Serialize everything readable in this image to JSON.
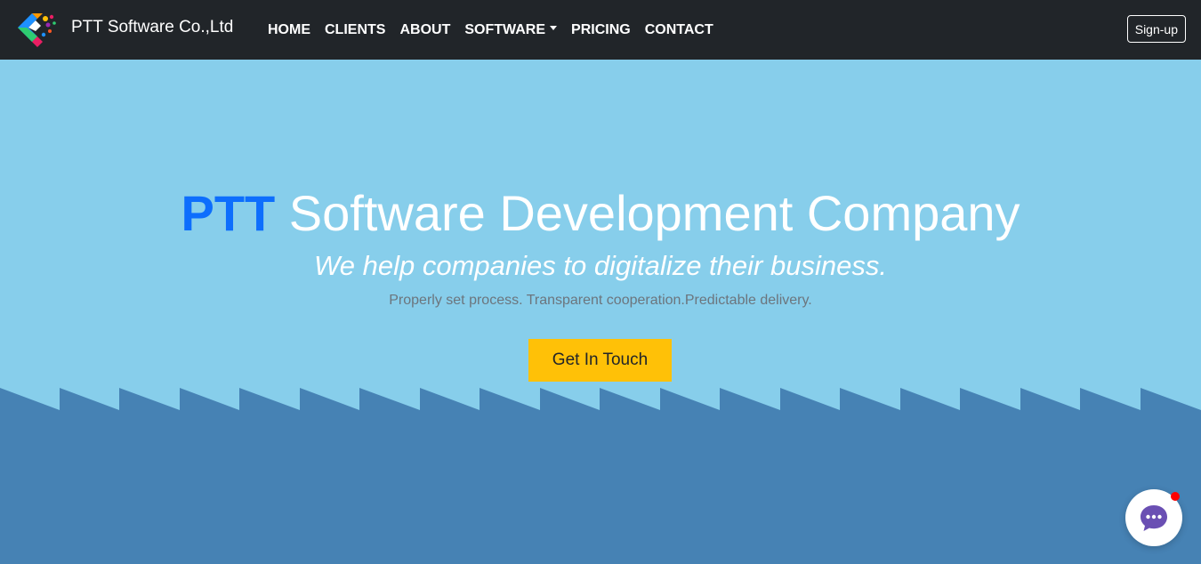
{
  "navbar": {
    "brand_name": "PTT Software Co.,Ltd",
    "logo_icon": "ptt-logo-icon",
    "links": [
      {
        "label": "HOME"
      },
      {
        "label": "CLIENTS"
      },
      {
        "label": "ABOUT"
      },
      {
        "label": "SOFTWARE",
        "dropdown": true
      },
      {
        "label": "PRICING"
      },
      {
        "label": "CONTACT"
      }
    ],
    "signup_label": "Sign-up"
  },
  "hero": {
    "title_highlight": "PTT",
    "title_rest": " Software Development Company",
    "subtitle": "We help companies to digitalize their business.",
    "lead": "Properly set process. Transparent cooperation.Predictable delivery.",
    "cta_label": "Get In Touch"
  },
  "chat_widget": {
    "icon": "chat-bubble-icon",
    "has_notification": true
  },
  "colors": {
    "navbar_bg": "#212529",
    "hero_bg": "#87ceeb",
    "wave": "#4682b4",
    "brand_blue": "#0d6efd",
    "cta": "#ffc107",
    "chat_purple": "#6a4fb3",
    "notification": "#ff0000"
  }
}
